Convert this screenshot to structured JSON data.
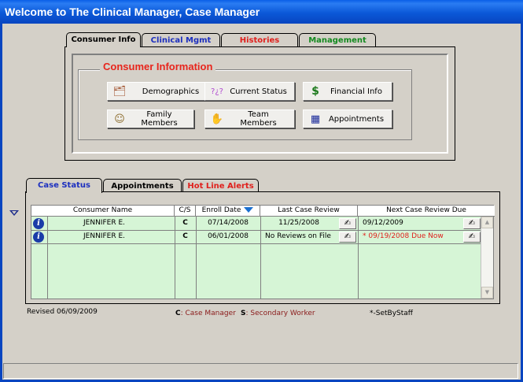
{
  "window": {
    "title": "Welcome to The Clinical Manager, Case Manager"
  },
  "top_tabs": [
    {
      "label": "Consumer Info",
      "color": "#000000",
      "active": true
    },
    {
      "label": "Clinical Mgmt",
      "color": "#1c2fbf",
      "active": false
    },
    {
      "label": "Histories",
      "color": "#e0201c",
      "active": false
    },
    {
      "label": "Management",
      "color": "#138a1f",
      "active": false
    }
  ],
  "consumer_info": {
    "group_title": "Consumer Information",
    "buttons": [
      {
        "label": "Demographics",
        "icon": "person-card-icon"
      },
      {
        "label": "Current Status",
        "icon": "question-marks-icon"
      },
      {
        "label": "Financial Info",
        "icon": "dollar-icon"
      },
      {
        "label": "Family Members",
        "icon": "family-icon"
      },
      {
        "label": "Team Members",
        "icon": "handshake-icon"
      },
      {
        "label": "Appointments",
        "icon": "calendar-icon"
      }
    ]
  },
  "bottom_tabs": [
    {
      "label": "Case Status",
      "color": "#1c2fbf",
      "active": true
    },
    {
      "label": "Appointments",
      "color": "#000000",
      "active": false
    },
    {
      "label": "Hot Line Alerts",
      "color": "#e0201c",
      "active": false
    }
  ],
  "case_grid": {
    "columns": [
      "Consumer Name",
      "C/S",
      "Enroll Date",
      "Last Case Review",
      "Next Case Review Due"
    ],
    "rows": [
      {
        "name": "JENNIFER E.",
        "cs": "C",
        "enroll": "07/14/2008",
        "last_review": "11/25/2008",
        "next_due": "09/12/2009",
        "overdue": false
      },
      {
        "name": "JENNIFER E.",
        "cs": "C",
        "enroll": "06/01/2008",
        "last_review": "No Reviews on File",
        "next_due": "* 09/19/2008 Due Now",
        "overdue": true
      }
    ]
  },
  "footer": {
    "revised": "Revised 06/09/2009",
    "legend_c_key": "C",
    "legend_c_text": ": Case Manager",
    "legend_s_key": "S",
    "legend_s_text": ": Secondary Worker",
    "set_by_staff": "*-SetByStaff"
  },
  "colors": {
    "grid_bg": "#d6f5d6",
    "overdue": "#e0201c",
    "legend_text": "#8a1a1a"
  }
}
